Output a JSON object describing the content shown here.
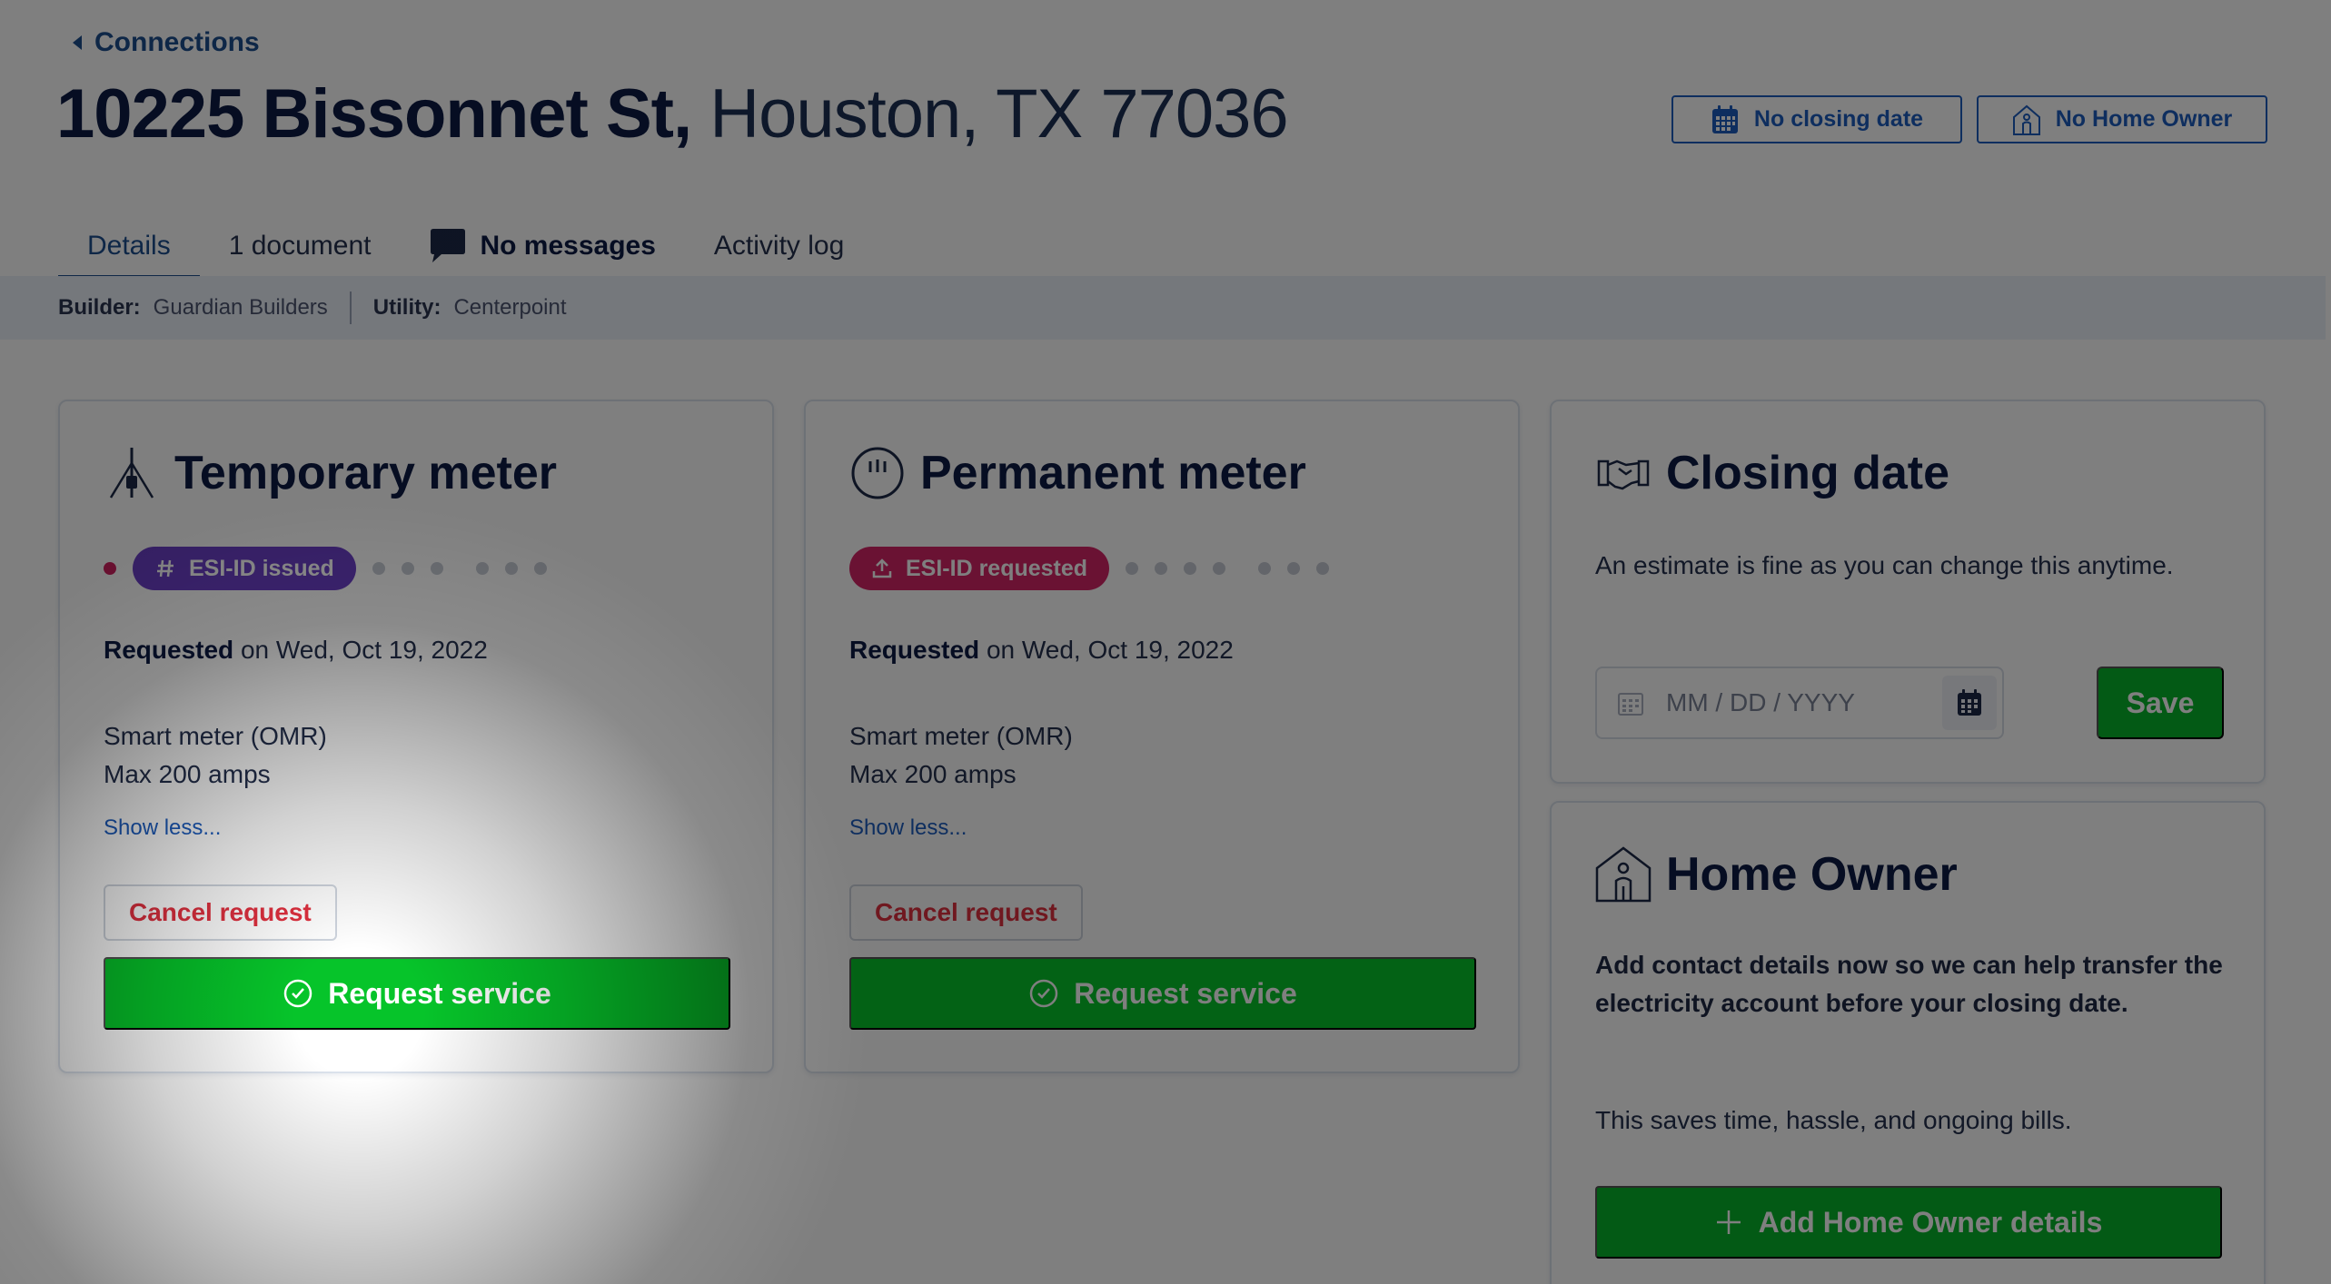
{
  "nav": {
    "back_label": "Connections"
  },
  "address": {
    "street": "10225 Bissonnet St,",
    "city": "Houston, TX 77036"
  },
  "header_buttons": {
    "closing": "No closing date",
    "owner": "No Home Owner"
  },
  "tabs": [
    {
      "label": "Details",
      "active": true
    },
    {
      "label": "1 document"
    },
    {
      "label": "No messages"
    },
    {
      "label": "Activity log"
    }
  ],
  "info": {
    "builder_label": "Builder:",
    "builder_value": "Guardian Builders",
    "utility_label": "Utility:",
    "utility_value": "Centerpoint"
  },
  "temporary_meter": {
    "title": "Temporary meter",
    "badge": "ESI-ID issued",
    "requested_label": "Requested",
    "requested_date": "on Wed, Oct 19, 2022",
    "meter_type": "Smart meter (OMR)",
    "max_amps": "Max 200 amps",
    "show_less": "Show less...",
    "cancel": "Cancel request",
    "request": "Request service"
  },
  "permanent_meter": {
    "title": "Permanent meter",
    "badge": "ESI-ID requested",
    "requested_label": "Requested",
    "requested_date": "on Wed, Oct 19, 2022",
    "meter_type": "Smart meter (OMR)",
    "max_amps": "Max 200 amps",
    "show_less": "Show less...",
    "cancel": "Cancel request",
    "request": "Request service"
  },
  "closing_date": {
    "title": "Closing date",
    "description": "An estimate is fine as you can change this anytime.",
    "placeholder": "MM / DD / YYYY",
    "save": "Save"
  },
  "home_owner": {
    "title": "Home Owner",
    "bold_text": "Add contact details now so we can help transfer the electricity account before your closing date.",
    "description": "This saves time, hassle, and ongoing bills.",
    "add_button": "Add Home Owner details"
  },
  "colors": {
    "primary_blue": "#1d5dbf",
    "navy": "#0c1a44",
    "green": "#06c42a",
    "badge_purple": "#6b3fc7",
    "badge_magenta": "#d42466",
    "cancel_red": "#e0303f"
  }
}
